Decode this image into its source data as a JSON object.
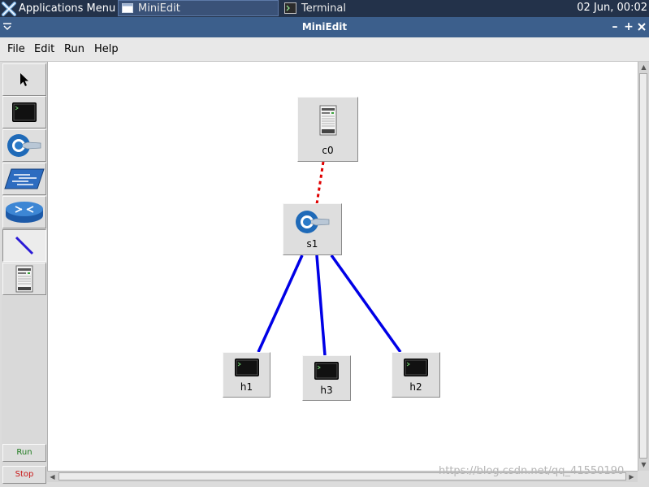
{
  "taskbar": {
    "apps_menu": "Applications Menu",
    "tasks": [
      {
        "label": "MiniEdit",
        "icon": "window-icon",
        "active": true
      },
      {
        "label": "Terminal",
        "icon": "terminal-icon",
        "active": false
      }
    ],
    "clock": "02 Jun, 00:02"
  },
  "window": {
    "title": "MiniEdit",
    "buttons": [
      "minimize",
      "maximize",
      "close"
    ]
  },
  "menu": {
    "items": [
      "File",
      "Edit",
      "Run",
      "Help"
    ]
  },
  "toolbar": {
    "tools": [
      {
        "name": "select",
        "icon": "cursor-arrow-icon"
      },
      {
        "name": "host",
        "icon": "host-terminal-icon"
      },
      {
        "name": "switch",
        "icon": "openflow-switch-icon"
      },
      {
        "name": "legacy-switch",
        "icon": "legacy-switch-icon"
      },
      {
        "name": "legacy-router",
        "icon": "router-icon"
      },
      {
        "name": "link",
        "icon": "link-line-icon",
        "selected": true
      },
      {
        "name": "controller",
        "icon": "controller-server-icon"
      }
    ],
    "run_label": "Run",
    "stop_label": "Stop"
  },
  "topology": {
    "nodes": [
      {
        "id": "c0",
        "label": "c0",
        "type": "controller"
      },
      {
        "id": "s1",
        "label": "s1",
        "type": "switch"
      },
      {
        "id": "h1",
        "label": "h1",
        "type": "host"
      },
      {
        "id": "h3",
        "label": "h3",
        "type": "host"
      },
      {
        "id": "h2",
        "label": "h2",
        "type": "host"
      }
    ],
    "links": [
      {
        "from": "c0",
        "to": "s1",
        "kind": "control",
        "color": "#e00000"
      },
      {
        "from": "s1",
        "to": "h1",
        "kind": "data",
        "color": "#0000e6"
      },
      {
        "from": "s1",
        "to": "h3",
        "kind": "data",
        "color": "#0000e6"
      },
      {
        "from": "s1",
        "to": "h2",
        "kind": "data",
        "color": "#0000e6"
      }
    ]
  },
  "watermark": "https://blog.csdn.net/qq_41550190",
  "colors": {
    "taskbar": "#23324a",
    "titlebar": "#3c5f8c",
    "run_text": "#1e7a1e",
    "stop_text": "#c81414"
  }
}
